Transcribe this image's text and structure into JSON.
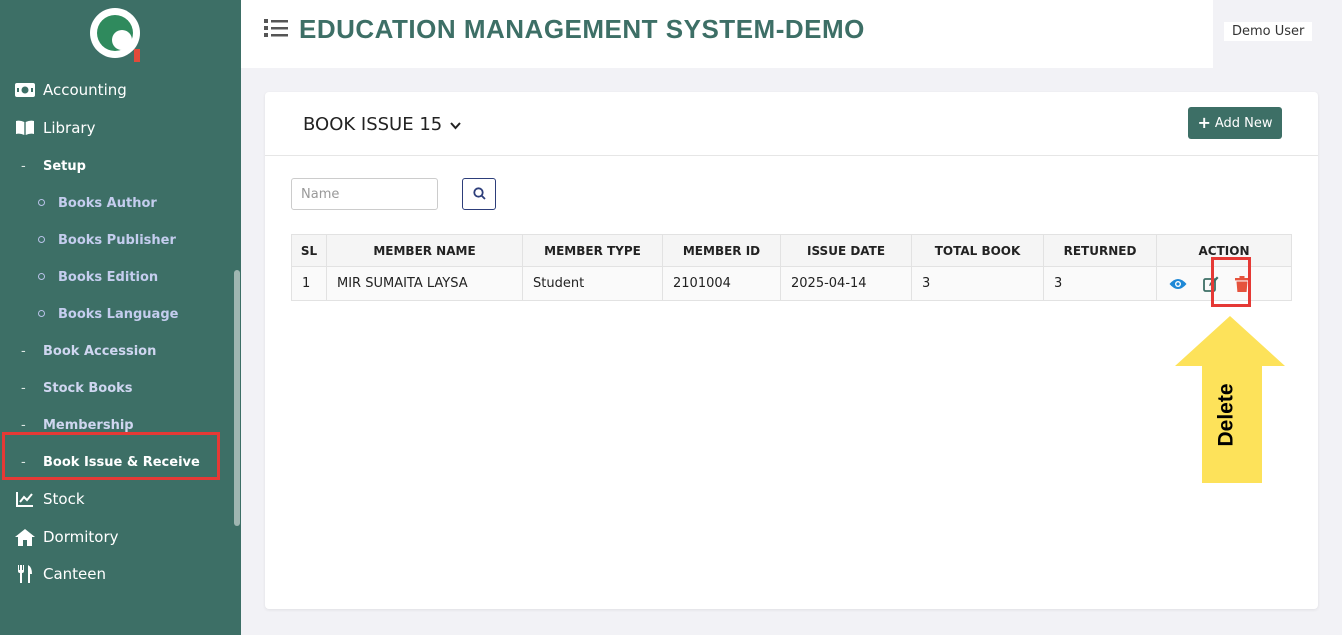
{
  "app": {
    "title": "EDUCATION MANAGEMENT SYSTEM-DEMO",
    "user": "Demo User"
  },
  "sidebar": {
    "items": [
      {
        "label": "Accounting",
        "icon": "money-bill-icon"
      },
      {
        "label": "Library",
        "icon": "book-open-icon"
      },
      {
        "label": "Setup"
      },
      {
        "label": "Books Author"
      },
      {
        "label": "Books Publisher"
      },
      {
        "label": "Books Edition"
      },
      {
        "label": "Books Language"
      },
      {
        "label": "Book Accession"
      },
      {
        "label": "Stock Books"
      },
      {
        "label": "Membership"
      },
      {
        "label": "Book Issue & Receive"
      },
      {
        "label": "Stock",
        "icon": "chart-line-icon"
      },
      {
        "label": "Dormitory",
        "icon": "home-icon"
      },
      {
        "label": "Canteen",
        "icon": "utensils-icon"
      }
    ]
  },
  "page": {
    "title": "BOOK ISSUE 15",
    "add_label": "Add New",
    "search_placeholder": "Name"
  },
  "table": {
    "headers": [
      "SL",
      "MEMBER NAME",
      "MEMBER TYPE",
      "MEMBER ID",
      "ISSUE DATE",
      "TOTAL BOOK",
      "RETURNED",
      "ACTION"
    ],
    "rows": [
      [
        "1",
        "MIR SUMAITA LAYSA",
        "Student",
        "2101004",
        "2025-04-14",
        "3",
        "3"
      ]
    ]
  },
  "annotation": {
    "label": "Delete"
  },
  "colors": {
    "sidebar": "#3d6f66",
    "accent": "#3d6f66",
    "highlight": "#e53935",
    "arrow": "#fde25a",
    "view_icon": "#1e88d6",
    "delete_icon": "#e5533d"
  }
}
